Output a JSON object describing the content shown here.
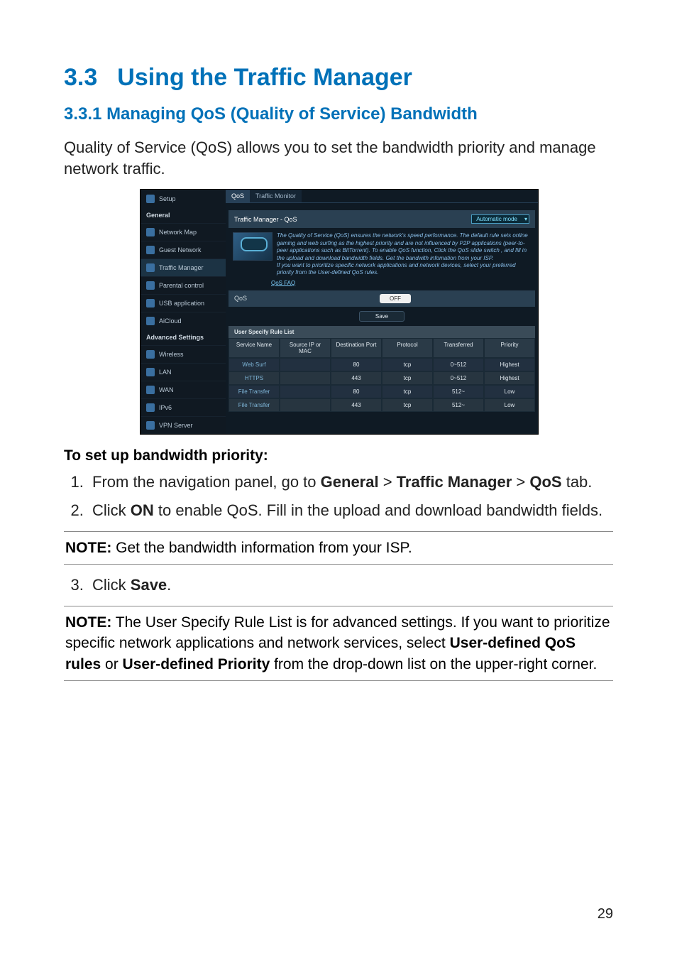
{
  "section": {
    "number": "3.3",
    "title": "Using the Traffic Manager"
  },
  "subsection": {
    "number": "3.3.1",
    "title": "Managing QoS (Quality of Service) Bandwidth"
  },
  "intro": "Quality of Service (QoS) allows you to set the bandwidth priority and manage network traffic.",
  "priority_heading": "To set up bandwidth priority:",
  "steps": [
    {
      "pre": "From the navigation panel, go to ",
      "b1": "General",
      "sep1": " > ",
      "b2": "Traffic Manager",
      "sep2": " > ",
      "b3": "QoS",
      "post": " tab."
    },
    {
      "pre": "Click ",
      "b1": "ON",
      "post": " to enable QoS. Fill in the upload and download bandwidth fields."
    }
  ],
  "note1": {
    "label": "NOTE:",
    "text": " Get the bandwidth information from your ISP."
  },
  "step3": {
    "pre": "Click ",
    "b1": "Save",
    "post": "."
  },
  "note2": {
    "label": "NOTE:",
    "l1": "   The User Specify Rule List is for advanced settings. If you want to prioritize specific network applications and network services, select ",
    "b1": "User-defined QoS rules",
    "or": " or ",
    "b2": "User-defined Priority",
    "l2": " from the drop-down list on the upper-right corner."
  },
  "page_number": "29",
  "screenshot": {
    "tabs": [
      "QoS",
      "Traffic Monitor"
    ],
    "panel_title": "Traffic Manager - QoS",
    "mode": "Automatic mode",
    "side": {
      "general": "General",
      "items": [
        "Network Map",
        "Guest Network",
        "Traffic Manager",
        "Parental control",
        "USB application",
        "AiCloud"
      ],
      "advanced": "Advanced Settings",
      "adv_items": [
        "Wireless",
        "LAN",
        "WAN",
        "IPv6",
        "VPN Server"
      ],
      "setup": "Setup"
    },
    "desc": [
      "The Quality of Service (QoS) ensures the network's speed performance. The default rule sets online gaming and web surfing as the highest priority and are not influenced by P2P applications (peer-to-peer applications such as BitTorrent). To enable QoS function, Click the QoS slide switch , and fill in the upload and download bandwidth fields. Get the bandwith infomation from your ISP.",
      "If you want to prioritize specific network applications and network devices, select your preferred priority from the User-defined QoS rules."
    ],
    "faq": "QoS FAQ",
    "qos_label": "QoS",
    "off": "OFF",
    "save": "Save",
    "rule_list_title": "User Specify Rule List",
    "columns": [
      "Service Name",
      "Source IP or MAC",
      "Destination Port",
      "Protocol",
      "Transferred",
      "Priority"
    ],
    "rows": [
      {
        "service": "Web Surf",
        "src": "",
        "dest": "80",
        "proto": "tcp",
        "trans": "0~512",
        "prio": "Highest"
      },
      {
        "service": "HTTPS",
        "src": "",
        "dest": "443",
        "proto": "tcp",
        "trans": "0~512",
        "prio": "Highest"
      },
      {
        "service": "File Transfer",
        "src": "",
        "dest": "80",
        "proto": "tcp",
        "trans": "512~",
        "prio": "Low"
      },
      {
        "service": "File Transfer",
        "src": "",
        "dest": "443",
        "proto": "tcp",
        "trans": "512~",
        "prio": "Low"
      }
    ]
  }
}
